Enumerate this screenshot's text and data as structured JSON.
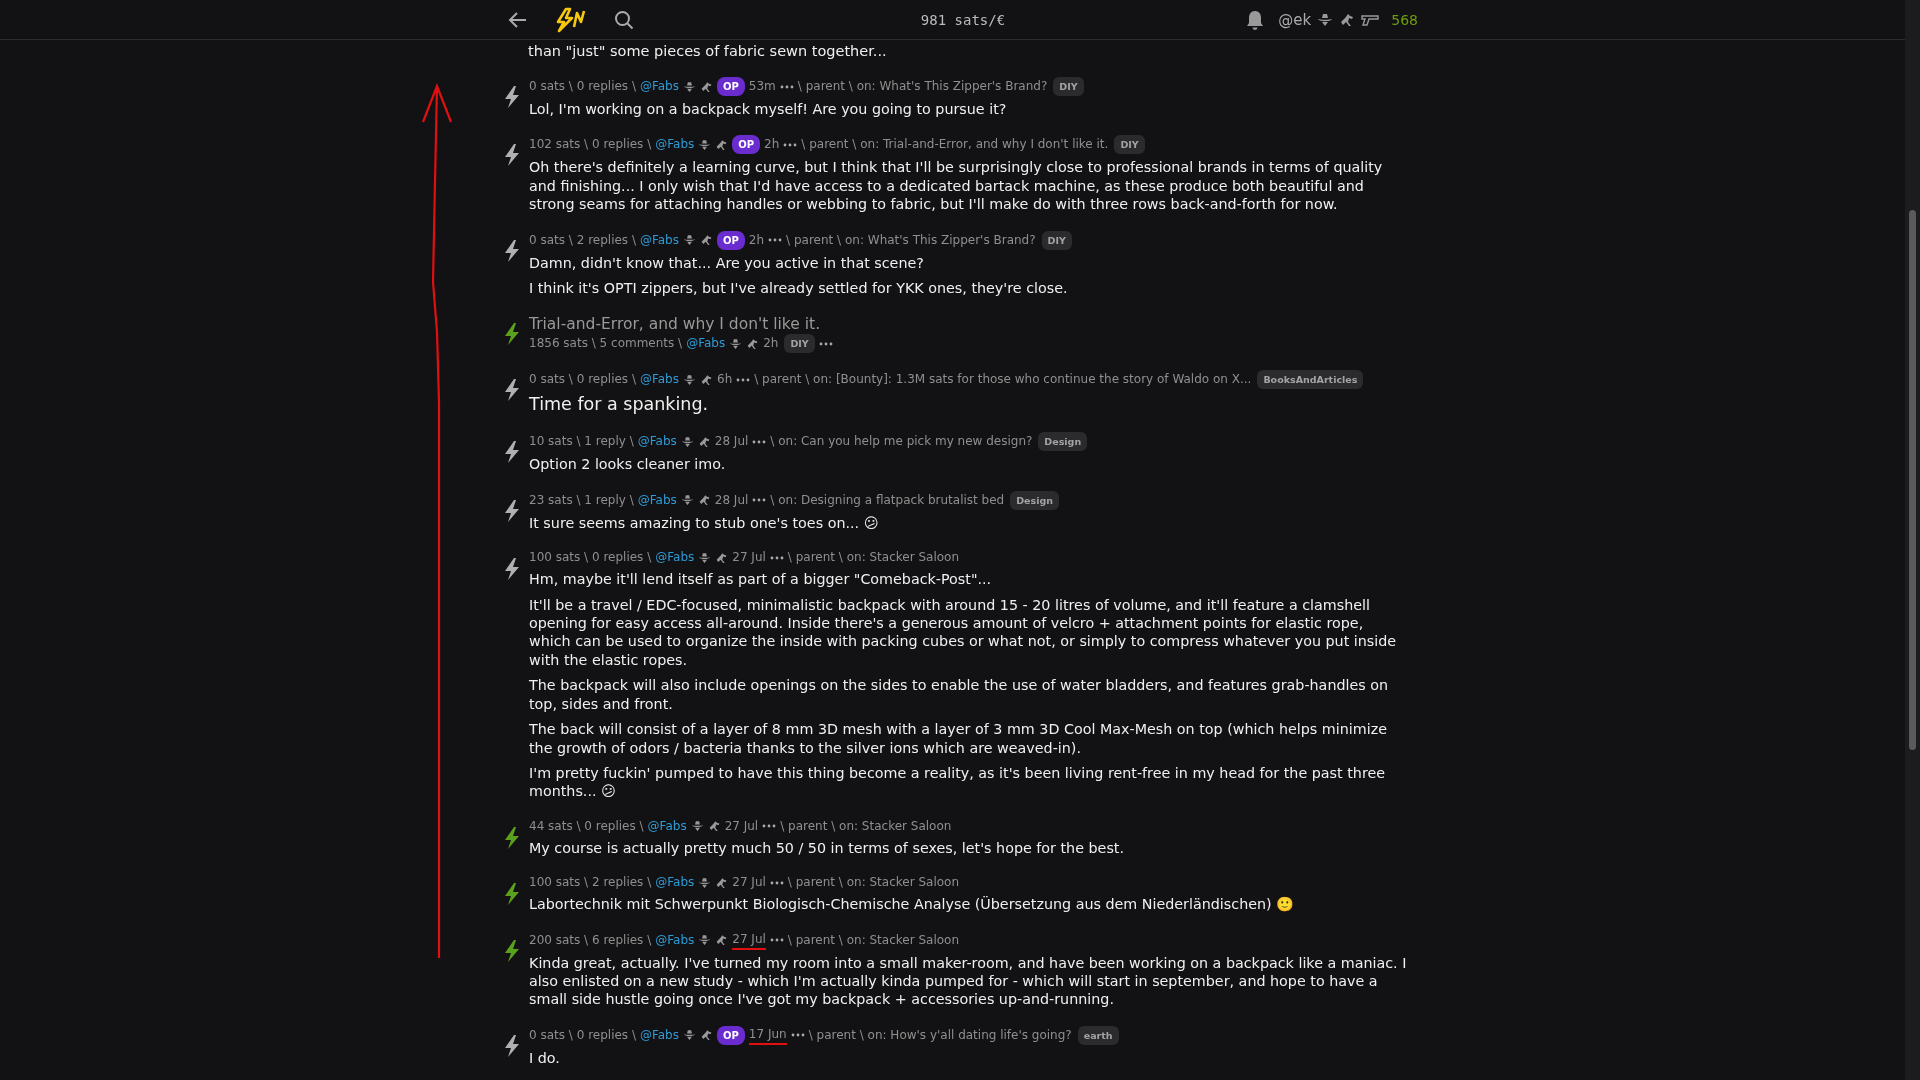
{
  "header": {
    "price": "981 sats/€",
    "user": "@ek",
    "balance": "568"
  },
  "top_fragment": "than \"just\" some pieces of fabric sewn together...",
  "items": [
    {
      "kind": "comment",
      "zapped": false,
      "marked": false,
      "stats": "0 sats \\ 0 replies \\",
      "user": "@Fabs",
      "badge": "OP",
      "time": "53m",
      "context": "\\ parent \\ on: What's This Zipper's Brand?",
      "tag": "DIY",
      "paragraphs": [
        "Lol, I'm working on a backpack myself! Are you going to pursue it?"
      ]
    },
    {
      "kind": "comment",
      "zapped": false,
      "marked": false,
      "stats": "102 sats \\ 0 replies \\",
      "user": "@Fabs",
      "badge": "OP",
      "time": "2h",
      "context": "\\ parent \\ on: Trial-and-Error, and why I don't like it.",
      "tag": "DIY",
      "paragraphs": [
        "Oh there's definitely a learning curve, but I think that I'll be surprisingly close to professional brands in terms of quality and finishing... I only wish that I'd have access to a dedicated bartack machine, as these produce both beautiful and strong seams for attaching handles or webbing to fabric, but I'll make do with three rows back-and-forth for now."
      ]
    },
    {
      "kind": "comment",
      "zapped": false,
      "marked": false,
      "stats": "0 sats \\ 2 replies \\",
      "user": "@Fabs",
      "badge": "OP",
      "time": "2h",
      "context": "\\ parent \\ on: What's This Zipper's Brand?",
      "tag": "DIY",
      "paragraphs": [
        "Damn, didn't know that... Are you active in that scene?",
        "I think it's OPTI zippers, but I've already settled for YKK ones, they're close."
      ]
    },
    {
      "kind": "post",
      "zapped": true,
      "marked": false,
      "title": "Trial-and-Error, and why I don't like it.",
      "stats": "1856 sats \\ 5 comments \\",
      "user": "@Fabs",
      "time": "2h",
      "tag": "DIY"
    },
    {
      "kind": "comment",
      "zapped": false,
      "marked": false,
      "large": true,
      "stats": "0 sats \\ 0 replies \\",
      "user": "@Fabs",
      "time": "6h",
      "context": "\\ parent \\ on: [Bounty]: 1.3M sats for those who continue the story of Waldo on X...",
      "tag": "BooksAndArticles",
      "paragraphs": [
        "Time for a spanking."
      ]
    },
    {
      "kind": "comment",
      "zapped": false,
      "marked": false,
      "stats": "10 sats \\ 1 reply \\",
      "user": "@Fabs",
      "time": "28 Jul",
      "context": "\\ on: Can you help me pick my new design?",
      "tag": "Design",
      "paragraphs": [
        "Option 2 looks cleaner imo."
      ]
    },
    {
      "kind": "comment",
      "zapped": false,
      "marked": false,
      "stats": "23 sats \\ 1 reply \\",
      "user": "@Fabs",
      "time": "28 Jul",
      "context": "\\ on: Designing a flatpack brutalist bed",
      "tag": "Design",
      "paragraphs": [
        "It sure seems amazing to stub one's toes on... 😕"
      ]
    },
    {
      "kind": "comment",
      "zapped": false,
      "marked": false,
      "stats": "100 sats \\ 0 replies \\",
      "user": "@Fabs",
      "time": "27 Jul",
      "context": "\\ parent \\ on: Stacker Saloon",
      "paragraphs": [
        "Hm, maybe it'll lend itself as part of a bigger \"Comeback-Post\"...",
        "It'll be a travel / EDC-focused, minimalistic backpack with around 15 - 20 litres of volume, and it'll feature a clamshell opening for easy access all-around. Inside there's a generous amount of velcro + attachment points for elastic rope, which can be used to organize the inside with packing cubes or what not, or simply to compress whatever you put inside with the elastic ropes.",
        "The backpack will also include openings on the sides to enable the use of water bladders, and features grab-handles on top, sides and front.",
        "The back will consist of a layer of 8 mm 3D mesh with a layer of 3 mm 3D Cool Max-Mesh on top (which helps minimize the growth of odors / bacteria thanks to the silver ions which are weaved-in).",
        "I'm pretty fuckin' pumped to have this thing become a reality, as it's been living rent-free in my head for the past three months... 😕"
      ]
    },
    {
      "kind": "comment",
      "zapped": true,
      "marked": false,
      "stats": "44 sats \\ 0 replies \\",
      "user": "@Fabs",
      "time": "27 Jul",
      "context": "\\ parent \\ on: Stacker Saloon",
      "paragraphs": [
        "My course is actually pretty much 50 / 50 in terms of sexes, let's hope for the best."
      ]
    },
    {
      "kind": "comment",
      "zapped": true,
      "marked": false,
      "stats": "100 sats \\ 2 replies \\",
      "user": "@Fabs",
      "time": "27 Jul",
      "context": "\\ parent \\ on: Stacker Saloon",
      "paragraphs": [
        "Labortechnik mit Schwerpunkt Biologisch-Chemische Analyse (Übersetzung aus dem Niederländischen) 🙂"
      ]
    },
    {
      "kind": "comment",
      "zapped": true,
      "marked": true,
      "stats": "200 sats \\ 6 replies \\",
      "user": "@Fabs",
      "time": "27 Jul",
      "context": "\\ parent \\ on: Stacker Saloon",
      "paragraphs": [
        "Kinda great, actually. I've turned my room into a small maker-room, and have been working on a backpack like a maniac. I also enlisted on a new study - which I'm actually kinda pumped for - which will start in september, and hope to have a small side hustle going once I've got my backpack + accessories up-and-running."
      ]
    },
    {
      "kind": "comment",
      "zapped": false,
      "marked": true,
      "stats": "0 sats \\ 0 replies \\",
      "user": "@Fabs",
      "badge": "OP",
      "time": "17 Jun",
      "context": "\\ parent \\ on: How's y'all dating life's going?",
      "tag": "earth",
      "paragraphs": [
        "I do."
      ]
    }
  ]
}
